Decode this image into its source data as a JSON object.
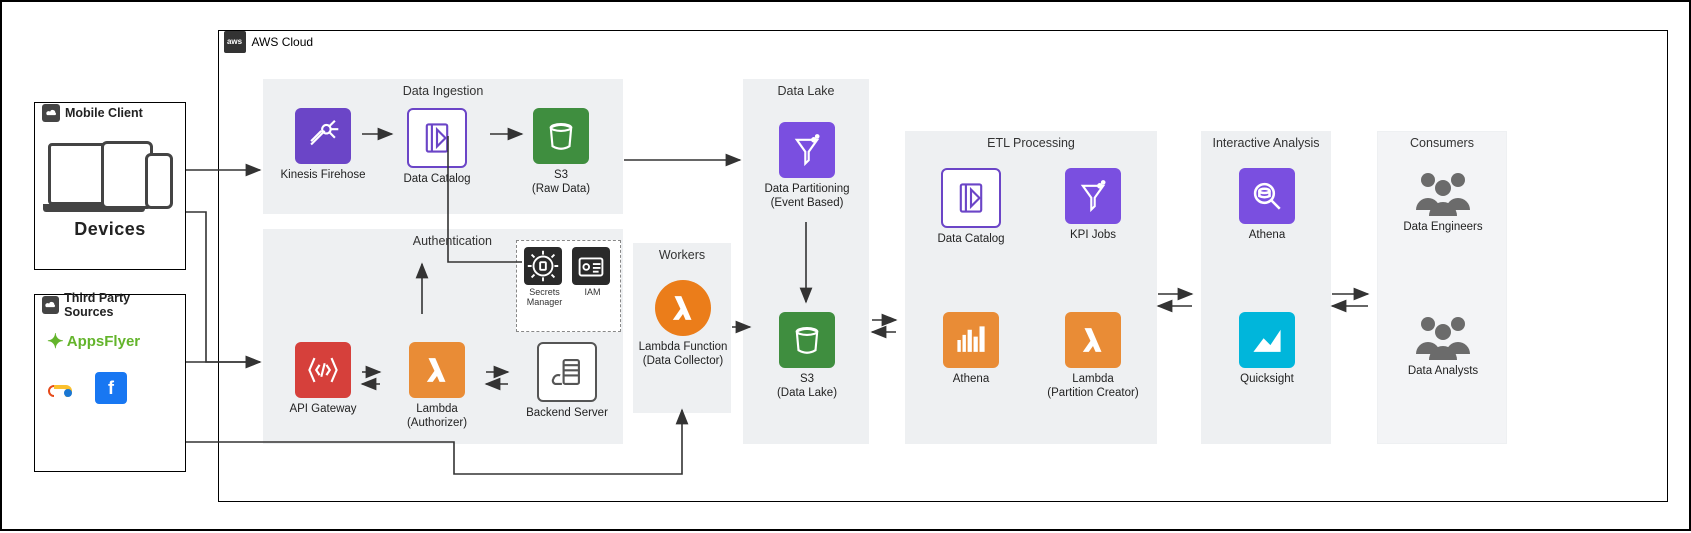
{
  "cloud": {
    "title": "AWS Cloud",
    "logo": "aws"
  },
  "sources": {
    "mobile": {
      "title": "Mobile Client",
      "caption": "Devices"
    },
    "third_party": {
      "title": "Third Party Sources",
      "appsflyer": "AppsFlyer",
      "admob_icon": "admob-icon",
      "facebook_icon": "facebook-icon",
      "facebook_letter": "f"
    }
  },
  "groups": {
    "ingestion": {
      "title": "Data Ingestion",
      "kinesis": "Kinesis Firehose",
      "catalog": "Data Catalog",
      "s3": "S3",
      "s3_sub": "(Raw Data)"
    },
    "auth": {
      "title": "Authentication",
      "api_gw": "API Gateway",
      "lambda": "Lambda",
      "lambda_sub": "(Authorizer)",
      "secrets": "Secrets Manager",
      "iam": "IAM",
      "backend": "Backend Server"
    },
    "workers": {
      "title": "Workers",
      "lambda": "Lambda Function",
      "lambda_sub": "(Data Collector)"
    },
    "lake": {
      "title": "Data Lake",
      "partitioning": "Data Partitioning",
      "partitioning_sub": "(Event Based)",
      "s3": "S3",
      "s3_sub": "(Data Lake)"
    },
    "etl": {
      "title": "ETL Processing",
      "catalog": "Data Catalog",
      "kpi": "KPI Jobs",
      "athena": "Athena",
      "lambda": "Lambda",
      "lambda_sub": "(Partition Creator)"
    },
    "analysis": {
      "title": "Interactive Analysis",
      "athena": "Athena",
      "quicksight": "Quicksight"
    },
    "consumers": {
      "title": "Consumers",
      "eng": "Data Engineers",
      "analysts": "Data Analysts"
    }
  }
}
